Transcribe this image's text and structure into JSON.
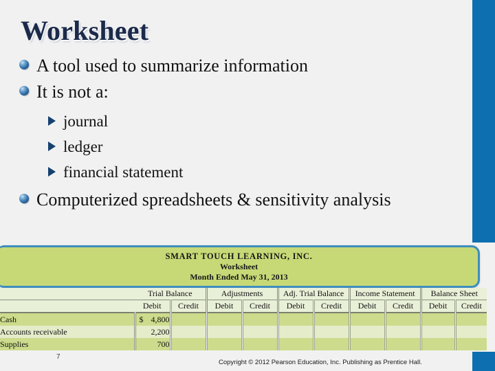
{
  "slide": {
    "title": "Worksheet",
    "page_number": "7",
    "copyright": "Copyright © 2012 Pearson Education, Inc. Publishing as Prentice Hall."
  },
  "colors": {
    "accent_blue": "#0d6fb0",
    "title_navy": "#1b2a4a",
    "exhibit_green": "#c7d977",
    "exhibit_border_blue": "#3d8dbd",
    "row_dark": "#ccdc8c",
    "row_light": "#e4ecca",
    "header_band": "#e9f0d8",
    "background": "#f1f1f1"
  },
  "bullets": [
    {
      "text": "A tool used to summarize information",
      "subs": []
    },
    {
      "text": "It is not a:",
      "subs": [
        "journal",
        "ledger",
        "financial statement"
      ]
    },
    {
      "text": "Computerized spreadsheets & sensitivity analysis",
      "subs": []
    }
  ],
  "exhibit": {
    "company": "SMART TOUCH LEARNING, INC.",
    "doc_title": "Worksheet",
    "period": "Month Ended May 31, 2013",
    "column_groups": [
      "Trial Balance",
      "Adjustments",
      "Adj. Trial Balance",
      "Income Statement",
      "Balance Sheet"
    ],
    "sub_headers": [
      "Debit",
      "Credit"
    ],
    "rows": [
      {
        "account": "Cash",
        "currency": "$",
        "tb_debit": "4,800",
        "tb_credit": "",
        "adj_debit": "",
        "adj_credit": "",
        "atb_debit": "",
        "atb_credit": "",
        "is_debit": "",
        "is_credit": "",
        "bs_debit": "",
        "bs_credit": ""
      },
      {
        "account": "Accounts receivable",
        "currency": "",
        "tb_debit": "2,200",
        "tb_credit": "",
        "adj_debit": "",
        "adj_credit": "",
        "atb_debit": "",
        "atb_credit": "",
        "is_debit": "",
        "is_credit": "",
        "bs_debit": "",
        "bs_credit": ""
      },
      {
        "account": "Supplies",
        "currency": "",
        "tb_debit": "700",
        "tb_credit": "",
        "adj_debit": "",
        "adj_credit": "",
        "atb_debit": "",
        "atb_credit": "",
        "is_debit": "",
        "is_credit": "",
        "bs_debit": "",
        "bs_credit": ""
      }
    ]
  }
}
